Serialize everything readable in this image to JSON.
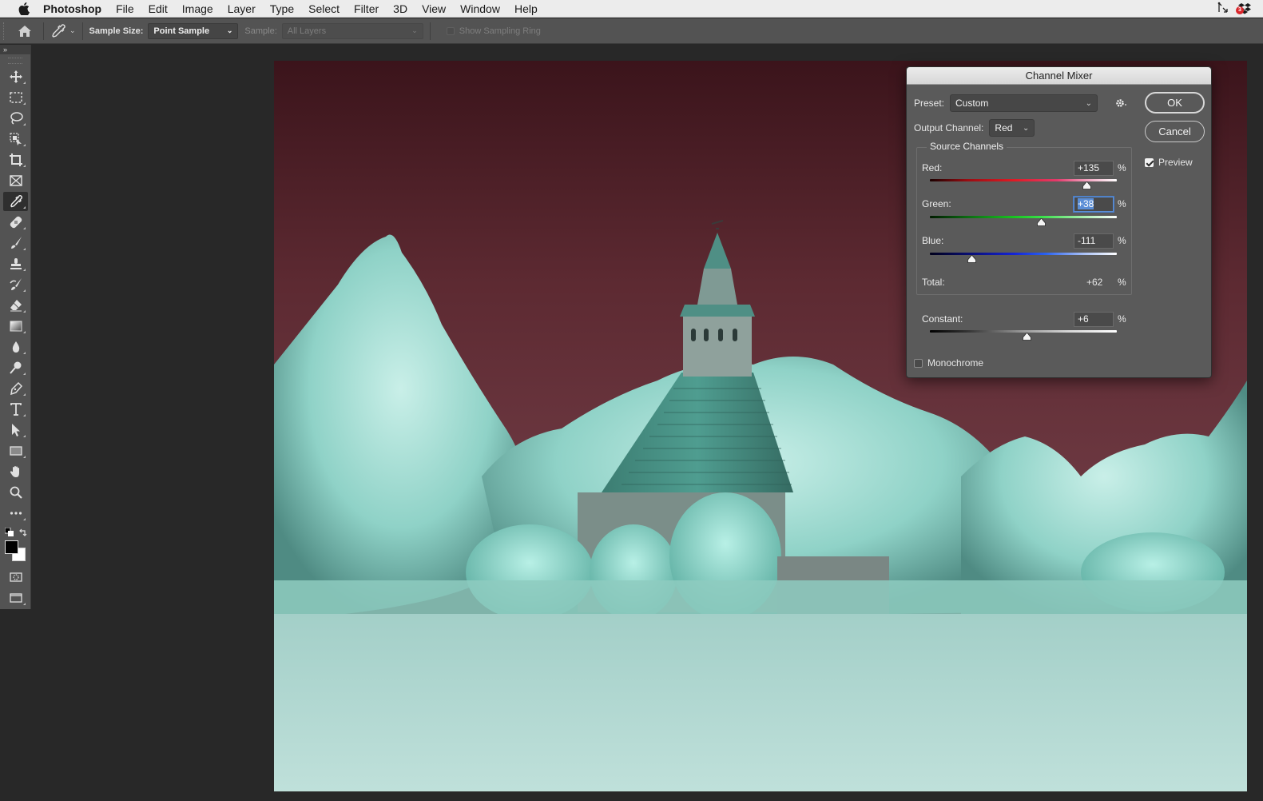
{
  "menubar": {
    "app_name": "Photoshop",
    "items": [
      "File",
      "Edit",
      "Image",
      "Layer",
      "Type",
      "Select",
      "Filter",
      "3D",
      "View",
      "Window",
      "Help"
    ],
    "status_icons": [
      "pen-tool-status-icon",
      "dropbox-icon"
    ],
    "dropbox_badge": "3"
  },
  "options_bar": {
    "sample_size_label": "Sample Size:",
    "sample_size_value": "Point Sample",
    "sample_label": "Sample:",
    "sample_value": "All Layers",
    "show_sampling_ring_label": "Show Sampling Ring",
    "show_sampling_ring_checked": false
  },
  "toolbar": {
    "collapse_label": "»",
    "tools": [
      {
        "name": "move-tool",
        "icon": "move-icon"
      },
      {
        "name": "rectangular-marquee-tool",
        "icon": "marquee-icon"
      },
      {
        "name": "lasso-tool",
        "icon": "lasso-icon"
      },
      {
        "name": "object-selection-tool",
        "icon": "object-selection-icon"
      },
      {
        "name": "crop-tool",
        "icon": "crop-icon"
      },
      {
        "name": "frame-tool",
        "icon": "frame-icon"
      },
      {
        "name": "eyedropper-tool",
        "icon": "eyedropper-icon",
        "active": true
      },
      {
        "name": "healing-brush-tool",
        "icon": "bandage-icon"
      },
      {
        "name": "brush-tool",
        "icon": "brush-icon"
      },
      {
        "name": "clone-stamp-tool",
        "icon": "stamp-icon"
      },
      {
        "name": "history-brush-tool",
        "icon": "history-brush-icon"
      },
      {
        "name": "eraser-tool",
        "icon": "eraser-icon"
      },
      {
        "name": "gradient-tool",
        "icon": "gradient-icon"
      },
      {
        "name": "blur-tool",
        "icon": "drop-icon"
      },
      {
        "name": "dodge-tool",
        "icon": "dodge-icon"
      },
      {
        "name": "pen-tool",
        "icon": "pen-icon"
      },
      {
        "name": "type-tool",
        "icon": "type-icon"
      },
      {
        "name": "path-selection-tool",
        "icon": "arrow-icon"
      },
      {
        "name": "rectangle-tool",
        "icon": "rectangle-icon"
      },
      {
        "name": "hand-tool",
        "icon": "hand-icon"
      },
      {
        "name": "zoom-tool",
        "icon": "magnifier-icon"
      },
      {
        "name": "edit-toolbar",
        "icon": "more-icon"
      }
    ],
    "foreground_color": "#000000",
    "background_color": "#ffffff"
  },
  "dialog": {
    "title": "Channel Mixer",
    "preset_label": "Preset:",
    "preset_value": "Custom",
    "output_channel_label": "Output Channel:",
    "output_channel_value": "Red",
    "ok_label": "OK",
    "cancel_label": "Cancel",
    "preview_label": "Preview",
    "preview_checked": true,
    "source_channels_title": "Source Channels",
    "channels": [
      {
        "label": "Red:",
        "value": "+135",
        "numeric": 135,
        "unit": "%"
      },
      {
        "label": "Green:",
        "value": "+38",
        "numeric": 38,
        "unit": "%",
        "focused": true
      },
      {
        "label": "Blue:",
        "value": "-111",
        "numeric": -111,
        "unit": "%"
      }
    ],
    "slider_range": [
      -200,
      200
    ],
    "total_label": "Total:",
    "total_value": "+62",
    "total_unit": "%",
    "constant_label": "Constant:",
    "constant_value": "+6",
    "constant_numeric": 6,
    "constant_unit": "%",
    "monochrome_label": "Monochrome",
    "monochrome_checked": false
  }
}
